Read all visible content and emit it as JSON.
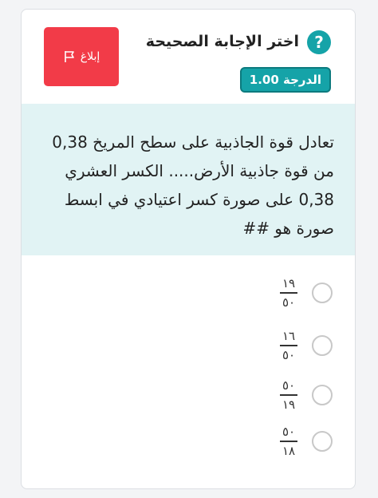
{
  "header": {
    "help_icon": "?",
    "title": "اختر الإجابة الصحيحة",
    "grade": "الدرجة 1.00",
    "report_label": "إبلاغ"
  },
  "question": {
    "text": "تعادل قوة الجاذبية على سطح المريخ 0,38 من قوة جاذبية الأرض..... الكسر العشري 0,38 على صورة كسر اعتيادي في ابسط صورة هو ##"
  },
  "options": [
    {
      "numerator": "١٩",
      "denominator": "٥٠"
    },
    {
      "numerator": "١٦",
      "denominator": "٥٠"
    },
    {
      "numerator": "٥٠",
      "denominator": "١٩"
    },
    {
      "numerator": "٥٠",
      "denominator": "١٨"
    }
  ],
  "colors": {
    "accent": "#15a3a8",
    "report": "#f23b48",
    "question_bg": "#e1f3f4"
  }
}
